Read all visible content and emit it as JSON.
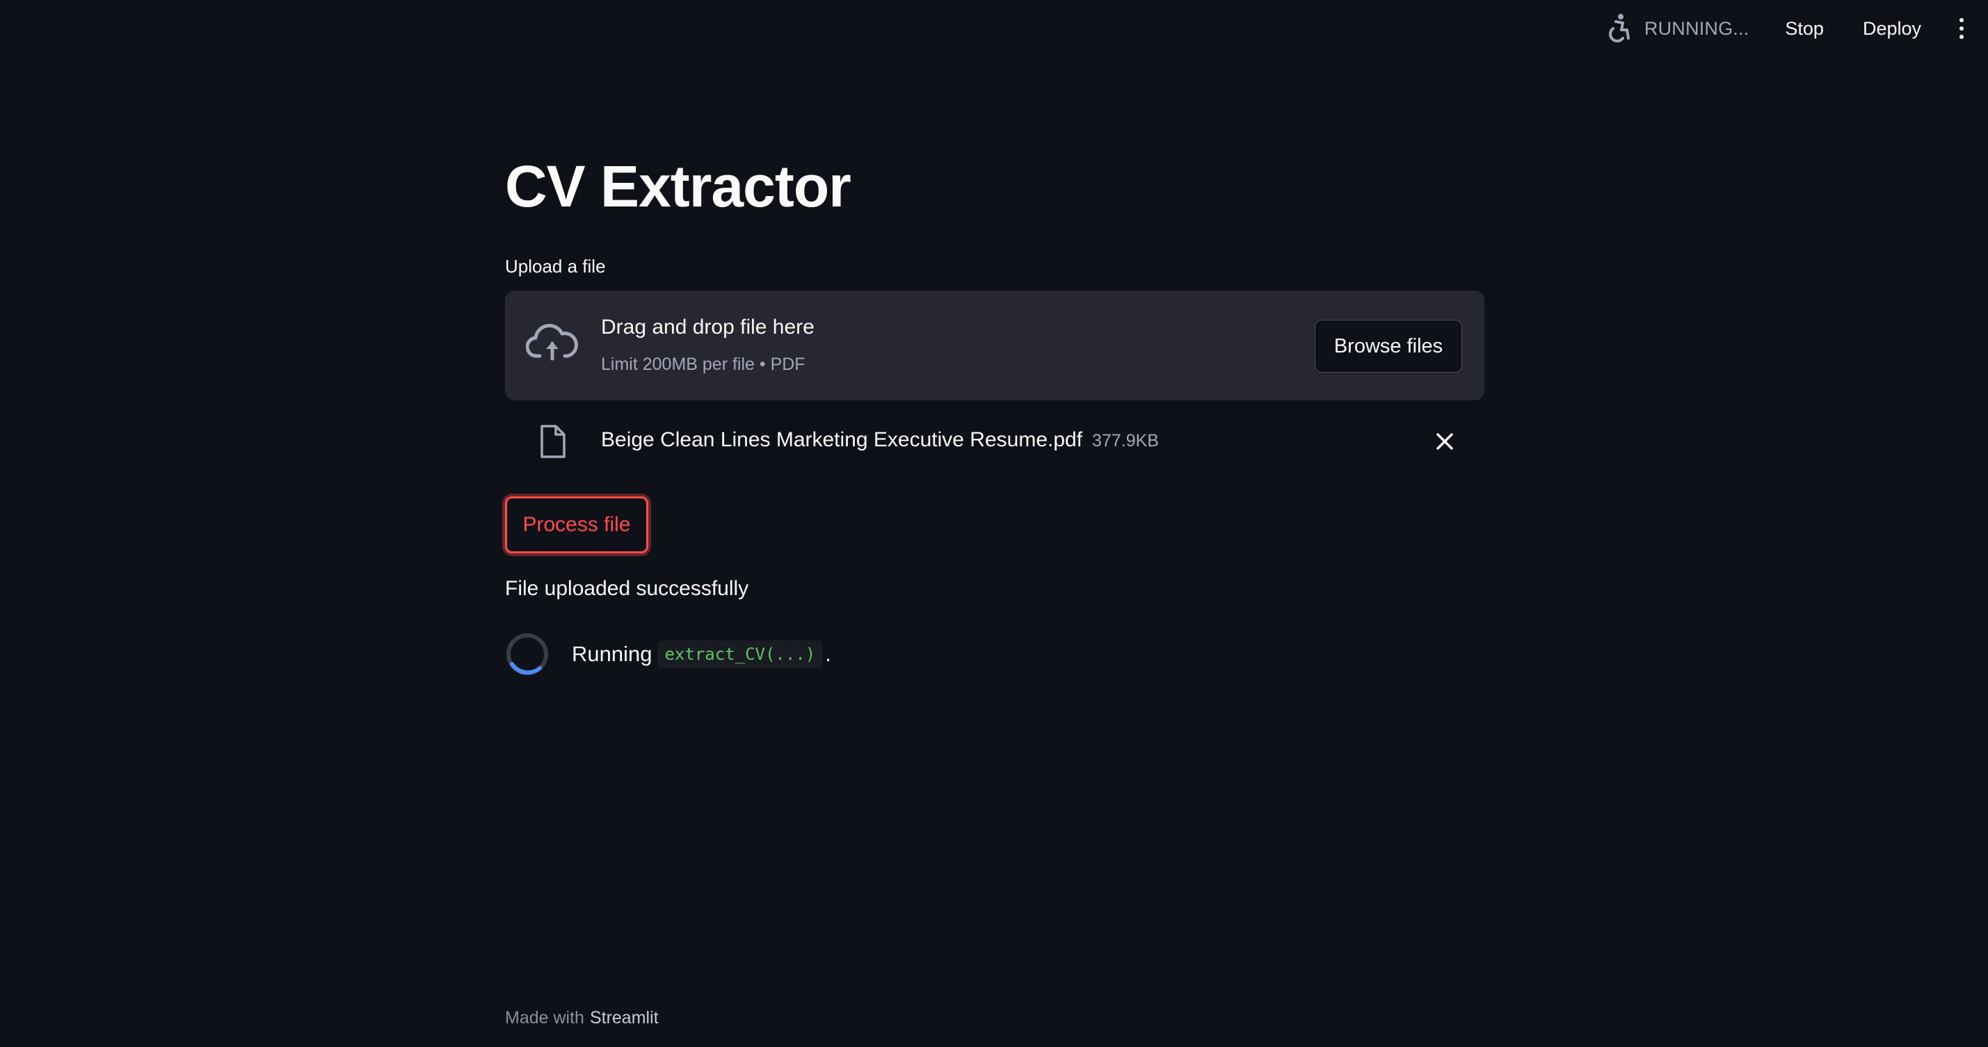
{
  "toolbar": {
    "status_icon": "running-person-icon",
    "status_text": "RUNNING...",
    "stop_label": "Stop",
    "deploy_label": "Deploy",
    "menu_icon": "kebab-menu-icon"
  },
  "main": {
    "title": "CV Extractor",
    "uploader": {
      "label": "Upload a file",
      "dropzone_title": "Drag and drop file here",
      "dropzone_subtitle": "Limit 200MB per file • PDF",
      "browse_label": "Browse files",
      "upload_icon": "cloud-upload-icon"
    },
    "uploaded_file": {
      "name": "Beige Clean Lines Marketing Executive Resume.pdf",
      "size": "377.9KB",
      "file_icon": "document-icon",
      "remove_icon": "close-icon"
    },
    "process_button_label": "Process file",
    "success_message": "File uploaded successfully",
    "running": {
      "label": "Running",
      "code": "extract_CV(...)",
      "suffix": "."
    }
  },
  "footer": {
    "prefix": "Made with",
    "brand": "Streamlit"
  },
  "colors": {
    "background": "#0e1117",
    "panel": "#262730",
    "accent_red": "#ff4b4b",
    "code_green": "#5ec464",
    "spinner_blue": "#4a8cf0"
  }
}
